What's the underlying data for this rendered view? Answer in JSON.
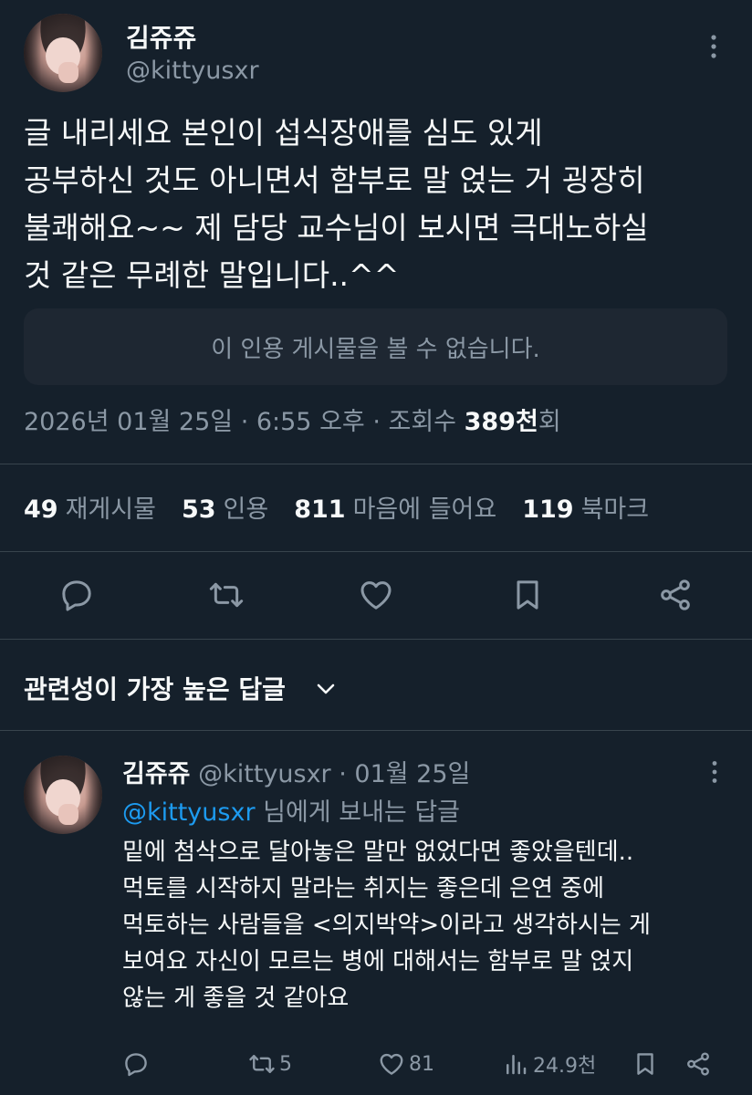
{
  "tweet": {
    "author": {
      "display_name": "김쥬쥬",
      "handle": "@kittyusxr"
    },
    "text": "글 내리세요 본인이 섭식장애를 심도 있게\n공부하신 것도 아니면서 함부로 말 얹는 거 굉장히\n불쾌해요~~ 제 담당 교수님이 보시면 극대노하실\n것 같은 무례한 말입니다..^^",
    "quote_unavailable": "이 인용 게시물을 볼 수 없습니다.",
    "meta": {
      "timestamp": "2026년 01월 25일 · 6:55 오후 · 조회수 ",
      "views": "389천",
      "views_suffix": "회"
    },
    "stats": {
      "reposts": {
        "num": "49",
        "label": "재게시물"
      },
      "quotes": {
        "num": "53",
        "label": "인용"
      },
      "likes": {
        "num": "811",
        "label": "마음에 들어요"
      },
      "bookmarks": {
        "num": "119",
        "label": "북마크"
      }
    },
    "actions": [
      "reply-icon",
      "repost-icon",
      "like-icon",
      "bookmark-icon",
      "share-icon"
    ]
  },
  "replies_section": {
    "sort_label": "관련성이 가장 높은 답글"
  },
  "reply": {
    "display_name": "김쥬쥬",
    "meta": " @kittyusxr · 01월 25일",
    "replying_to": "@kittyusxr",
    "replying_suffix": " 님에게 보내는 답글",
    "text": "밑에 첨삭으로 달아놓은 말만 없었다면 좋았을텐데..\n먹토를 시작하지 말라는 취지는 좋은데 은연 중에\n먹토하는 사람들을 <의지박약>이라고 생각하시는 게\n보여요 자신이 모르는 병에 대해서는 함부로 말 얹지\n않는 게 좋을 것 같아요",
    "actions": {
      "reply_count": "",
      "repost_count": "5",
      "like_count": "81",
      "view_count": "24.9천"
    }
  },
  "colors": {
    "background": "#15202b",
    "text_primary": "#f7f9f9",
    "text_secondary": "#8b98a5",
    "accent": "#1d9bf0",
    "divider": "#38444d"
  }
}
